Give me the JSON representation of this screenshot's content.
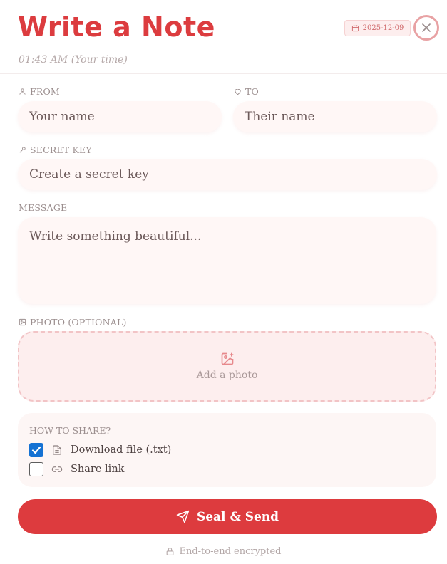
{
  "header": {
    "title": "Write a Note",
    "time": "01:43 AM (Your time)",
    "date": "2025-12-09"
  },
  "from": {
    "label": "FROM",
    "placeholder": "Your name",
    "icon": "user-icon"
  },
  "to": {
    "label": "TO",
    "placeholder": "Their name",
    "icon": "heart-icon"
  },
  "secret_key": {
    "label": "SECRET KEY",
    "placeholder": "Create a secret key",
    "icon": "key-icon"
  },
  "message": {
    "label": "MESSAGE",
    "placeholder": "Write something beautiful..."
  },
  "photo": {
    "label": "PHOTO (OPTIONAL)",
    "add_label": "Add a photo",
    "icon": "image-plus-icon"
  },
  "share": {
    "title": "HOW TO SHARE?",
    "options": [
      {
        "label": "Download file (.txt)",
        "checked": true,
        "icon": "file-icon"
      },
      {
        "label": "Share link",
        "checked": false,
        "icon": "link-icon"
      }
    ]
  },
  "send_label": "Seal & Send",
  "footer_text": "End-to-end encrypted",
  "colors": {
    "accent": "#dc3c3f",
    "checkbox": "#1572d3",
    "field_bg": "#fff7f6"
  }
}
